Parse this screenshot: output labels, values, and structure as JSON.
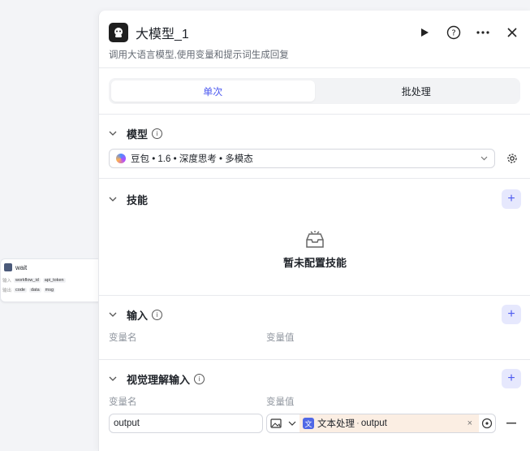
{
  "node": {
    "title": "wait",
    "input_label": "输入",
    "output_label": "输出",
    "inputs": [
      "workflow_id",
      "api_token"
    ],
    "outputs": [
      "code",
      "data",
      "msg"
    ]
  },
  "panel": {
    "title": "大模型_1",
    "description": "调用大语言模型,使用变量和提示词生成回复",
    "tabs": [
      "单次",
      "批处理"
    ],
    "active_tab": "单次"
  },
  "sections": {
    "model": {
      "title": "模型",
      "selected": "豆包 • 1.6 • 深度思考 • 多模态"
    },
    "skills": {
      "title": "技能",
      "empty": "暂未配置技能"
    },
    "input": {
      "title": "输入",
      "col_name": "变量名",
      "col_value": "变量值"
    },
    "vision": {
      "title": "视觉理解输入",
      "col_name": "变量名",
      "col_value": "变量值",
      "var_name": "output",
      "ref_node": "文本处理",
      "ref_field": "output"
    }
  },
  "icons": {
    "run": "play-icon",
    "help": "help-icon",
    "more": "more-icon",
    "close": "close-icon"
  },
  "colors": {
    "accent": "#4e5bf0",
    "ref_bg": "#fbeee3"
  }
}
